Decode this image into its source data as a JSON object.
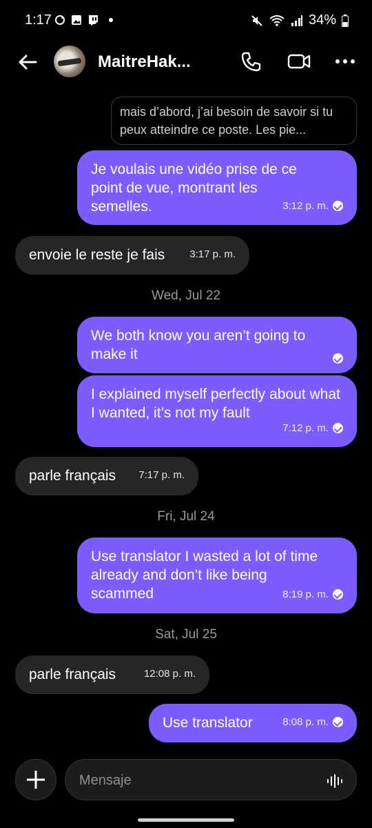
{
  "status_bar": {
    "time": "1:17",
    "battery": "34%"
  },
  "header": {
    "contact_name": "MaitreHak..."
  },
  "messages": [
    {
      "direction": "out-quote",
      "text": "mais d’abord, j’ai besoin de savoir si tu peux atteindre ce poste. Les pie..."
    },
    {
      "direction": "out",
      "text": "Je voulais une vidéo prise de ce point de vue, montrant les semelles.",
      "time": "3:12 p. m."
    },
    {
      "direction": "in",
      "text": "envoie le reste je fais",
      "time": "3:17 p. m."
    },
    {
      "direction": "date",
      "text": "Wed, Jul 22"
    },
    {
      "direction": "out",
      "text": "We both know you aren’t going to make it",
      "time": ""
    },
    {
      "direction": "out",
      "text": "I explained myself perfectly about what I wanted, it’s not my fault",
      "time": "7:12 p. m."
    },
    {
      "direction": "in",
      "text": "parle français",
      "time": "7:17 p. m."
    },
    {
      "direction": "date",
      "text": "Fri, Jul 24"
    },
    {
      "direction": "out",
      "text": "Use translator I wasted a lot of time already and don’t like being scammed",
      "time": "8:19 p. m."
    },
    {
      "direction": "date",
      "text": "Sat, Jul 25"
    },
    {
      "direction": "in",
      "text": "parle français",
      "time": "12:08 p. m."
    },
    {
      "direction": "out",
      "text": "Use translator",
      "time": "8:08 p. m."
    }
  ],
  "composer": {
    "placeholder": "Mensaje"
  },
  "icons": {
    "back": "arrow-left-icon",
    "call": "phone-icon",
    "video": "video-camera-icon",
    "more": "more-horizontal-icon",
    "add": "plus-icon",
    "voice": "waveform-icon"
  },
  "colors": {
    "outgoing_bubble": "#7c5cff",
    "incoming_bubble": "#262626",
    "background": "#000000"
  }
}
